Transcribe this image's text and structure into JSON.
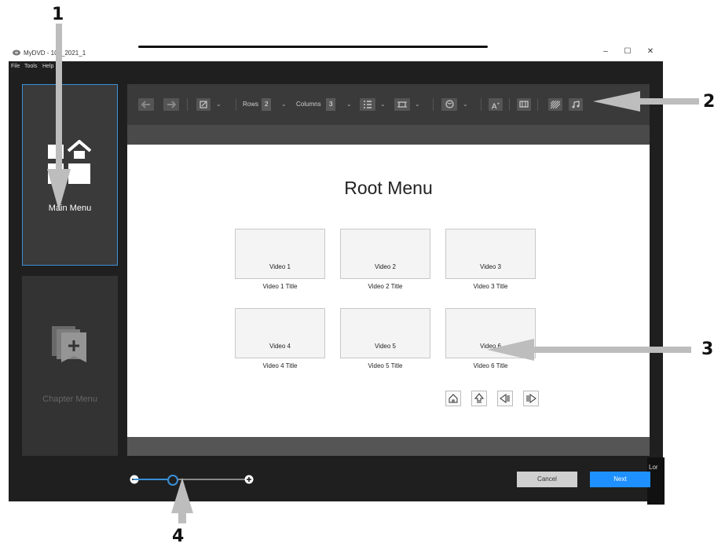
{
  "callouts": [
    "1",
    "2",
    "3",
    "4"
  ],
  "window": {
    "title": "MyDVD - 10__2021_1",
    "controls": {
      "minimize": "–",
      "maximize": "☐",
      "close": "✕"
    },
    "menu": [
      "File",
      "Tools",
      "Help"
    ]
  },
  "sidebar": {
    "main_menu_label": "Main Menu",
    "chapter_menu_label": "Chapter Menu"
  },
  "toolbar": {
    "rows_label": "Rows",
    "rows_value": "2",
    "columns_label": "Columns",
    "columns_value": "3",
    "icons": [
      "undo-icon",
      "redo-icon",
      "edit-icon",
      "list-layout-icon",
      "frame-icon",
      "globe-icon",
      "text-add-icon",
      "resize-icon",
      "pattern-icon",
      "music-icon"
    ]
  },
  "canvas": {
    "title": "Root Menu",
    "videos": [
      {
        "label": "Video 1",
        "title": "Video 1 Title"
      },
      {
        "label": "Video 2",
        "title": "Video 2 Title"
      },
      {
        "label": "Video 3",
        "title": "Video 3 Title"
      },
      {
        "label": "Video 4",
        "title": "Video 4 Title"
      },
      {
        "label": "Video 5",
        "title": "Video 5 Title"
      },
      {
        "label": "Video 6",
        "title": "Video 6 Title"
      }
    ],
    "nav_icons": [
      "home-icon",
      "up-icon",
      "prev-icon",
      "next-icon"
    ]
  },
  "footer": {
    "zoom_value": 0.35,
    "cancel_label": "Cancel",
    "next_label": "Next",
    "side_tab_label": "Lor"
  },
  "colors": {
    "accent": "#1e90ff",
    "selection_border": "#3a8fd6",
    "window_bg": "#1f1f1f"
  }
}
